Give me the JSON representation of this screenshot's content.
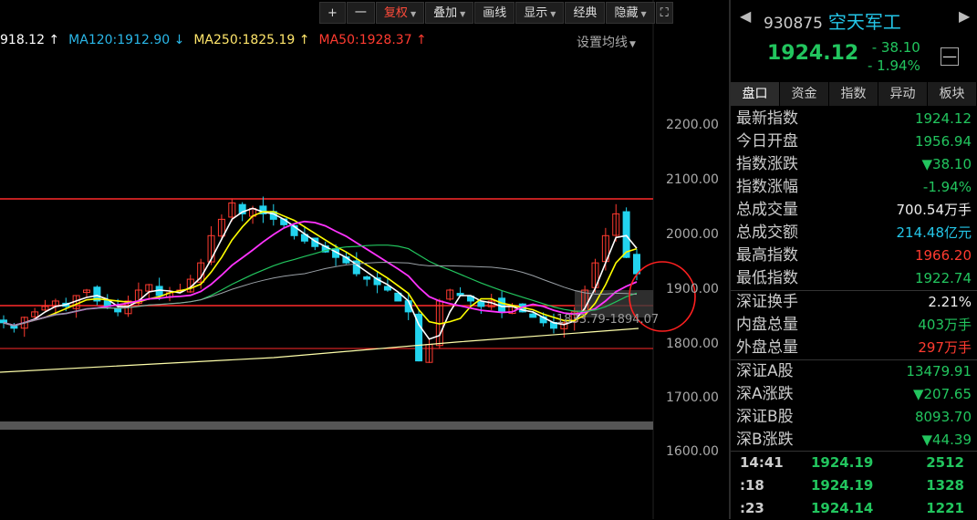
{
  "toolbar": {
    "plus": "+",
    "minus": "一",
    "fuquan": "复权",
    "diejia": "叠加",
    "huaxian": "画线",
    "xianshi": "显示",
    "jingdian": "经典",
    "yincang": "隐藏"
  },
  "ma_legend": [
    {
      "text": "918.12",
      "arrow": "↑",
      "color": "#ffffff"
    },
    {
      "text": "MA120:1912.90",
      "arrow": "↓",
      "color": "#2ab7e8"
    },
    {
      "text": "MA250:1825.19",
      "arrow": "↑",
      "color": "#ffe66b"
    },
    {
      "text": "MA50:1928.37",
      "arrow": "↑",
      "color": "#ff3b30"
    }
  ],
  "set_ma_label": "设置均线",
  "y_axis_labels": [
    "2200.00",
    "2100.00",
    "2000.00",
    "1900.00",
    "1800.00",
    "1700.00",
    "1600.00"
  ],
  "range_annotation": "1833.79-1894.07",
  "colors": {
    "up": "#ff3b30",
    "down": "#22d3ee",
    "ma5": "#ffffff",
    "ma10": "#ffff00",
    "ma20": "#ff33ff",
    "ma60": "#22c55e",
    "ma120": "#9aa0a6",
    "ma250": "#ffffaa"
  },
  "panel": {
    "code": "930875",
    "name": "空天军工",
    "price": "1924.12",
    "change": "- 38.10",
    "change_pct": "- 1.94%",
    "minimize": "—",
    "tabs": [
      "盘口",
      "资金",
      "指数",
      "异动",
      "板块"
    ],
    "stats": [
      {
        "label": "最新指数",
        "value": "1924.12",
        "color": "green"
      },
      {
        "label": "今日开盘",
        "value": "1956.94",
        "color": "green"
      },
      {
        "label": "指数涨跌",
        "value": "▼38.10",
        "color": "green"
      },
      {
        "label": "指数涨幅",
        "value": "-1.94%",
        "color": "green"
      },
      {
        "label": "总成交量",
        "value": "700.54万手",
        "color": "white"
      },
      {
        "label": "总成交额",
        "value": "214.48亿元",
        "color": "cyan"
      },
      {
        "label": "最高指数",
        "value": "1966.20",
        "color": "red"
      },
      {
        "label": "最低指数",
        "value": "1922.74",
        "color": "green"
      },
      {
        "label": "深证换手",
        "value": "2.21%",
        "color": "white",
        "sep": true
      },
      {
        "label": "内盘总量",
        "value": "403万手",
        "color": "green"
      },
      {
        "label": "外盘总量",
        "value": "297万手",
        "color": "red"
      },
      {
        "label": "深证A股",
        "value": "13479.91",
        "color": "green",
        "sep": true
      },
      {
        "label": "深A涨跌",
        "value": "▼207.65",
        "color": "green"
      },
      {
        "label": "深证B股",
        "value": "8093.70",
        "color": "green"
      },
      {
        "label": "深B涨跌",
        "value": "▼44.39",
        "color": "green"
      }
    ],
    "ticks": [
      {
        "time": "14:41",
        "price": "1924.19",
        "vol": "2512"
      },
      {
        "time": ":18",
        "price": "1924.19",
        "vol": "1328"
      },
      {
        "time": ":23",
        "price": "1924.14",
        "vol": "1221"
      }
    ]
  }
}
